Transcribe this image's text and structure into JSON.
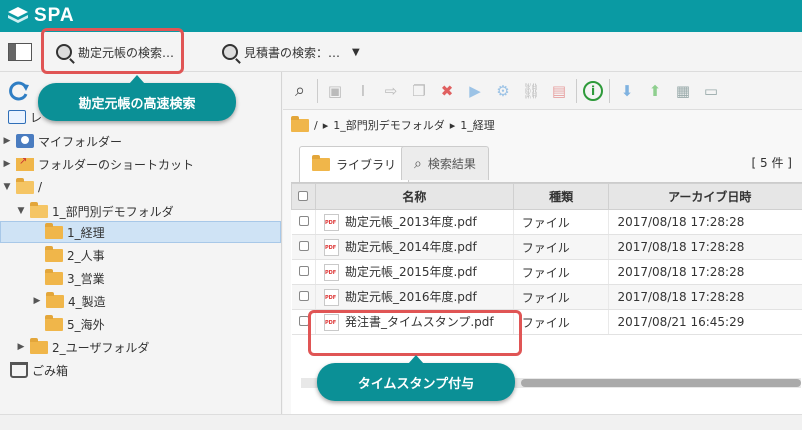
{
  "app": {
    "title": "SPA"
  },
  "search_bar": {
    "ledger_search_label": "勘定元帳の検索…",
    "quote_search_label": "見積書の検索：…"
  },
  "callouts": {
    "ledger_fast_search": "勘定元帳の高速検索",
    "timestamp": "タイムスタンプ付与"
  },
  "tree": {
    "recent_label": "レ",
    "items": [
      {
        "label": "マイフォルダー"
      },
      {
        "label": "フォルダーのショートカット"
      },
      {
        "label": "/"
      },
      {
        "label": "1_部門別デモフォルダ"
      },
      {
        "label": "1_経理"
      },
      {
        "label": "2_人事"
      },
      {
        "label": "3_営業"
      },
      {
        "label": "4_製造"
      },
      {
        "label": "5_海外"
      },
      {
        "label": "2_ユーザフォルダ"
      },
      {
        "label": "ごみ箱"
      }
    ]
  },
  "breadcrumb": {
    "root": "/",
    "folder1": "1_部門別デモフォルダ",
    "folder2": "1_経理"
  },
  "tabs": {
    "library": "ライブラリ",
    "search_results": "検索結果"
  },
  "count_text": "[ 5 件 ]",
  "table": {
    "headers": [
      "名称",
      "種類",
      "アーカイブ日時"
    ],
    "rows": [
      {
        "name": "勘定元帳_2013年度.pdf",
        "type": "ファイル",
        "date": "2017/08/18 17:28:28"
      },
      {
        "name": "勘定元帳_2014年度.pdf",
        "type": "ファイル",
        "date": "2017/08/18 17:28:28"
      },
      {
        "name": "勘定元帳_2015年度.pdf",
        "type": "ファイル",
        "date": "2017/08/18 17:28:28"
      },
      {
        "name": "勘定元帳_2016年度.pdf",
        "type": "ファイル",
        "date": "2017/08/18 17:28:28"
      },
      {
        "name": "発注書_タイムスタンプ.pdf",
        "type": "ファイル",
        "date": "2017/08/21 16:45:29"
      }
    ]
  },
  "colors": {
    "brand": "#0a9aa3",
    "callout": "#0b9096",
    "highlight": "#e05555"
  }
}
